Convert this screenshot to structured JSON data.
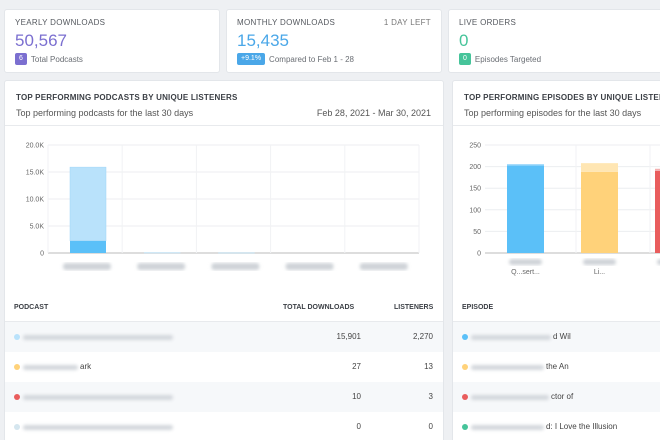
{
  "stats": {
    "yearly": {
      "title": "YEARLY DOWNLOADS",
      "value": "50,567",
      "badge": "6",
      "badge_color": "#7b6fd0",
      "sub": "Total Podcasts",
      "value_color": "#7b6fd0"
    },
    "monthly": {
      "title": "MONTHLY DOWNLOADS",
      "right": "1 DAY LEFT",
      "value": "15,435",
      "badge": "+9.1%",
      "badge_color": "#4aa7e8",
      "sub": "Compared to Feb 1 - 28",
      "value_color": "#4aa7e8"
    },
    "live": {
      "title": "LIVE ORDERS",
      "value": "0",
      "badge": "0",
      "badge_color": "#46c49a",
      "sub": "Episodes Targeted",
      "value_color": "#46c49a"
    }
  },
  "podcasts_panel": {
    "title": "TOP PERFORMING PODCASTS BY UNIQUE LISTENERS",
    "subtitle": "Top performing podcasts for the last 30 days",
    "date_range": "Feb 28, 2021 - Mar 30, 2021",
    "table": {
      "headers": {
        "podcast": "PODCAST",
        "total": "TOTAL DOWNLOADS",
        "listeners": "LISTENERS"
      },
      "rows": [
        {
          "name": "",
          "total": "15,901",
          "listeners": "2,270",
          "color": "#b9e2fb"
        },
        {
          "name": "ark",
          "total": "27",
          "listeners": "13",
          "color": "#ffd27a"
        },
        {
          "name": "",
          "total": "10",
          "listeners": "3",
          "color": "#e95d5d"
        },
        {
          "name": "",
          "total": "0",
          "listeners": "0",
          "color": "#d5e6ef"
        }
      ]
    }
  },
  "episodes_panel": {
    "title": "TOP PERFORMING EPISODES BY UNIQUE LISTENERS",
    "subtitle": "Top performing episodes for the last 30 days",
    "table": {
      "headers": {
        "episode": "EPISODE"
      },
      "rows": [
        {
          "name": "d Wil",
          "color": "#5bc0f8"
        },
        {
          "name": "the An",
          "color": "#ffd27a"
        },
        {
          "name": "ctor of",
          "color": "#e95d5d"
        },
        {
          "name": "d: I Love the Illusion",
          "color": "#46c49a"
        }
      ]
    }
  },
  "chart_data": [
    {
      "type": "bar",
      "title": "TOP PERFORMING PODCASTS BY UNIQUE LISTENERS",
      "categories": [
        "",
        "",
        "",
        "",
        ""
      ],
      "series": [
        {
          "values": [
            2270,
            13,
            3,
            0,
            0
          ],
          "color": "#5bc0f8"
        },
        {
          "values": [
            13631,
            14,
            7,
            0,
            0
          ],
          "color": "#b9e2fb"
        }
      ],
      "y_ticks": [
        "0",
        "5.0K",
        "10.0K",
        "15.0K",
        "20.0K"
      ],
      "ylim": [
        0,
        20000
      ],
      "grid": true
    },
    {
      "type": "bar",
      "title": "TOP PERFORMING EPISODES BY UNIQUE LISTENERS",
      "categories": [
        "Q...sert...",
        "Li...",
        ""
      ],
      "series": [
        {
          "values": [
            203,
            188,
            190
          ],
          "colors": [
            "#5bc0f8",
            "#ffd27a",
            "#e95d5d"
          ]
        },
        {
          "values": [
            3,
            20,
            5
          ],
          "colors": [
            "#a8dcfb",
            "#ffe6b3",
            "#f4b0b0"
          ]
        }
      ],
      "y_ticks": [
        "0",
        "50",
        "100",
        "150",
        "200",
        "250"
      ],
      "ylim": [
        0,
        250
      ],
      "grid": true
    }
  ]
}
